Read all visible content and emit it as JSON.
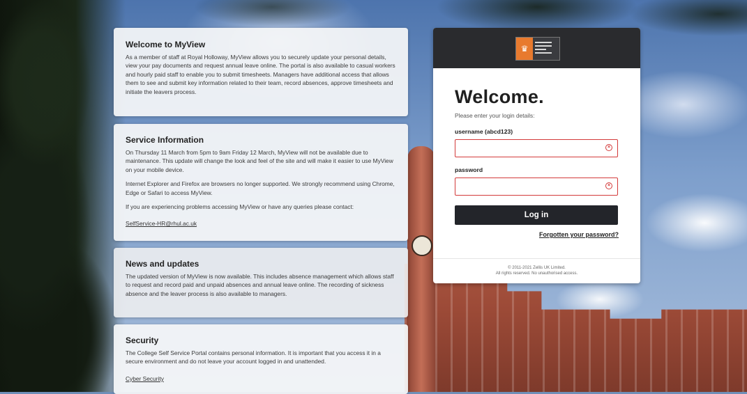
{
  "cards": {
    "welcome": {
      "title": "Welcome to MyView",
      "body": "As a member of staff at Royal Holloway, MyView allows you to securely update your personal details, view your pay documents and request annual leave online. The portal is also available to casual workers and hourly paid staff to enable you to submit timesheets. Managers have additional access that allows them to see and submit key information related to their team, record absences, approve timesheets and initiate the leavers process."
    },
    "service": {
      "title": "Service Information",
      "p1": "On Thursday 11 March from 5pm to 9am Friday 12 March, MyView will not be available due to maintenance. This update will change the look and feel of the site and will make it easier to use MyView on your mobile device.",
      "p2": "Internet Explorer and Firefox are browsers no longer supported. We strongly recommend using Chrome, Edge or Safari to access MyView.",
      "p3": "If you are experiencing problems accessing MyView or have any queries please contact:",
      "email": "SelfService-HR@rhul.ac.uk"
    },
    "news": {
      "title": "News and updates",
      "body": "The updated version of MyView is now available. This includes absence management which allows staff to request and record paid and unpaid absences and annual leave online. The recording of sickness absence and the leaver process is also available to managers."
    },
    "security": {
      "title": "Security",
      "body": "The College Self Service Portal contains personal information. It is important that you access it in a secure environment and do not leave your account logged in and unattended.",
      "link": "Cyber Security"
    }
  },
  "login": {
    "heading": "Welcome.",
    "instruction": "Please enter your login details:",
    "username_label": "username (abcd123)",
    "username_value": "",
    "password_label": "password",
    "password_value": "",
    "button_label": "Log in",
    "forgot_label": "Forgotten your password?",
    "footer_line1": "© 2011-2021 Zellis UK Limited.",
    "footer_line2": "All rights reserved. No unauthorised access.",
    "error_color": "#d33a3a",
    "logo_icon": "university-crest-icon"
  }
}
